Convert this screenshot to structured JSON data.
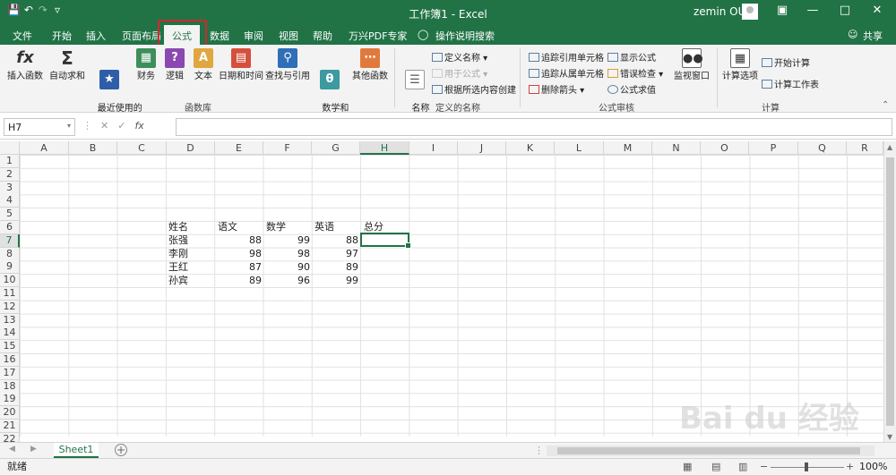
{
  "titlebar": {
    "title": "工作簿1 - Excel",
    "user": "zemin OU",
    "qat": [
      "save-icon",
      "undo-icon",
      "redo-icon",
      "customize-icon"
    ],
    "accent": "#217346"
  },
  "tabs": [
    "文件",
    "开始",
    "插入",
    "页面布局",
    "公式",
    "数据",
    "审阅",
    "视图",
    "帮助",
    "万兴PDF专家",
    "操作说明搜索"
  ],
  "share_label": "共享",
  "ribbon": {
    "function_library": {
      "label": "函数库",
      "buttons": [
        "插入函数",
        "自动求和",
        "最近使用的\n函数",
        "财务",
        "逻辑",
        "文本",
        "日期和时间",
        "查找与引用",
        "数学和\n三角函数",
        "其他函数"
      ]
    },
    "defined_names": {
      "label": "定义的名称",
      "manager": "名称\n管理器",
      "items": [
        "定义名称",
        "用于公式",
        "根据所选内容创建"
      ]
    },
    "formula_auditing": {
      "label": "公式审核",
      "items": [
        "追踪引用单元格",
        "追踪从属单元格",
        "删除箭头",
        "显示公式",
        "错误检查",
        "公式求值"
      ],
      "watch": "监视窗口"
    },
    "calculation": {
      "label": "计算",
      "options": "计算选项",
      "items": [
        "开始计算",
        "计算工作表"
      ]
    }
  },
  "formula_bar": {
    "name_box": "H7",
    "fx": "fx",
    "value": ""
  },
  "columns": [
    "A",
    "B",
    "C",
    "D",
    "E",
    "F",
    "G",
    "H",
    "I",
    "J",
    "K",
    "L",
    "M",
    "N",
    "O",
    "P",
    "Q",
    "R"
  ],
  "rows": [
    "1",
    "2",
    "3",
    "4",
    "5",
    "6",
    "7",
    "8",
    "9",
    "10",
    "11",
    "12",
    "13",
    "14",
    "15",
    "16",
    "17",
    "18",
    "19",
    "20",
    "21",
    "22"
  ],
  "table": {
    "headers": [
      "姓名",
      "语文",
      "数学",
      "英语",
      "总分"
    ],
    "rows": [
      {
        "name": "张强",
        "chinese": "88",
        "math": "99",
        "english": "88"
      },
      {
        "name": "李刚",
        "chinese": "98",
        "math": "98",
        "english": "97"
      },
      {
        "name": "王红",
        "chinese": "87",
        "math": "90",
        "english": "89"
      },
      {
        "name": "孙宾",
        "chinese": "89",
        "math": "96",
        "english": "99"
      }
    ]
  },
  "sheets": [
    "Sheet1"
  ],
  "status": {
    "ready": "就绪",
    "zoom": "100%"
  },
  "watermark": "Bai du 经验"
}
